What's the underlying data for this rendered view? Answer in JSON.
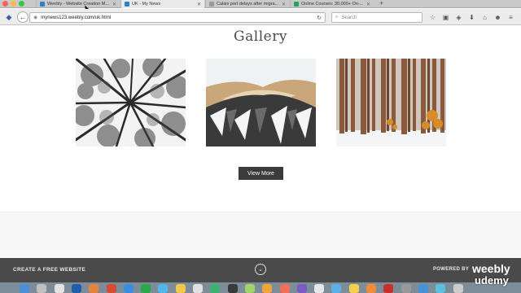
{
  "browser": {
    "tabs": [
      {
        "title": "Weebly - Website Creation M...",
        "favicon_color": "#2f80c9",
        "active": false
      },
      {
        "title": "UK - My News",
        "favicon_color": "#2f80c9",
        "active": true
      },
      {
        "title": "Calais port delays after migra...",
        "favicon_color": "#999999",
        "active": false
      },
      {
        "title": "Online Courses: 30,000+ On-...",
        "favicon_color": "#26a65b",
        "active": false
      }
    ],
    "new_tab": "+",
    "url": "mynews123.weebly.com/uk.html",
    "search_placeholder": "Search",
    "toolbar_icons": [
      "☆",
      "▣",
      "◈",
      "⬇",
      "⌂",
      "☻",
      "≡"
    ]
  },
  "page": {
    "title": "Gallery",
    "view_more_label": "View More",
    "images": [
      {
        "name": "forest-canopy-photo"
      },
      {
        "name": "ice-cave-photo"
      },
      {
        "name": "winter-forest-photo"
      }
    ]
  },
  "weebly_footer": {
    "create_label": "CREATE A FREE WEBSITE",
    "chevron": "⌄",
    "powered_by": "POWERED BY",
    "brand": "weebly"
  },
  "watermark": "udemy",
  "dock": {
    "apps": [
      "#4a90d9",
      "#c0c0c0",
      "#e3e3e3",
      "#1e5fa8",
      "#e8833a",
      "#d84a32",
      "#3a8de0",
      "#2aa84a",
      "#4db8e8",
      "#f1c84a",
      "#e0e0e0",
      "#3cb371",
      "#3a3a3a",
      "#a0d468",
      "#f2a33a",
      "#f26d5b",
      "#7b5cc4",
      "#e8e8e8",
      "#5ab0e8",
      "#f5d04a",
      "#f28c38",
      "#c9302c",
      "#999999",
      "#4a90d9",
      "#5bc0de",
      "#cccccc"
    ]
  }
}
